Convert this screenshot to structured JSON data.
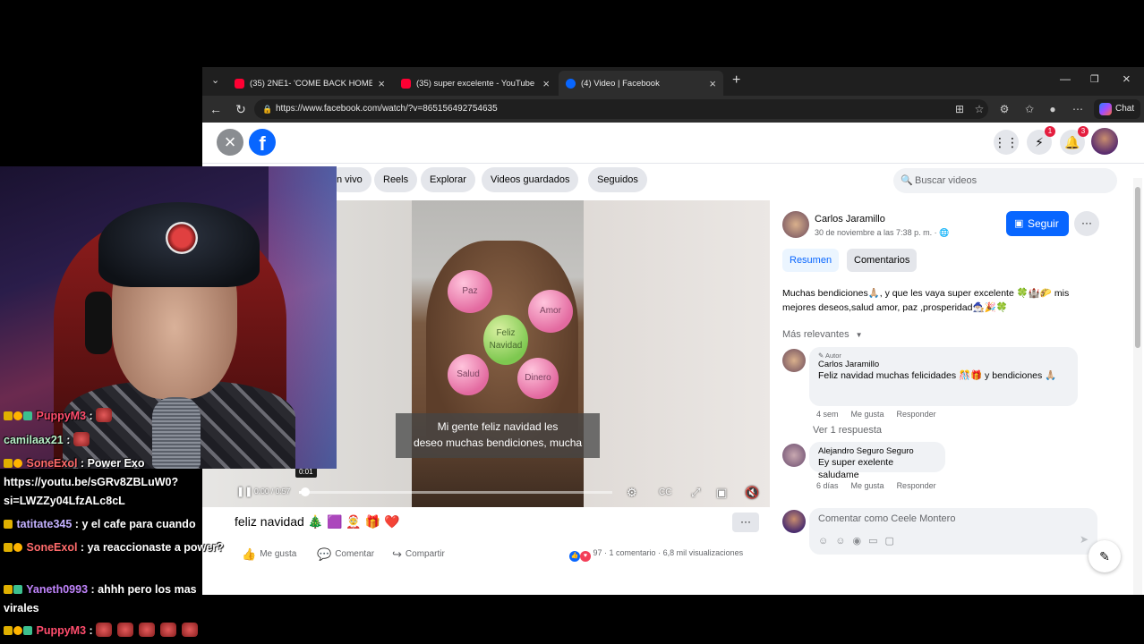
{
  "browser": {
    "tabs": [
      {
        "title": "(35) 2NE1- 'COME BACK HOME' 0:",
        "favicon": "youtube-icon",
        "color": "#ff0033"
      },
      {
        "title": "(35) super excelente - YouTube",
        "favicon": "youtube-icon",
        "color": "#ff0033"
      },
      {
        "title": "(4) Video | Facebook",
        "favicon": "facebook-icon",
        "color": "#0866ff"
      }
    ],
    "url": "https://www.facebook.com/watch/?v=865156492754635",
    "chat_label": "Chat"
  },
  "fb": {
    "messenger_badge": "1",
    "notif_badge": "3",
    "nav": [
      "n vivo",
      "Reels",
      "Explorar",
      "Videos guardados",
      "Seguidos"
    ],
    "search_placeholder": "Buscar videos",
    "video": {
      "balloons": [
        "Paz",
        "Amor",
        "Feliz Navidad",
        "Salud",
        "Dinero"
      ],
      "caption_line1": "Mi gente feliz navidad les",
      "caption_line2": "deseo muchas bendiciones, mucha",
      "time": "0:00 / 0:57",
      "hover_time": "0:01",
      "progress": 0.02,
      "title": "feliz navidad 🎄 🟪 🤶 🎁 ❤️"
    },
    "actions": {
      "like": "Me gusta",
      "comment": "Comentar",
      "share": "Compartir"
    },
    "stats": {
      "reactions": "97",
      "comments": "1 comentario",
      "views": "6,8 mil visualizaciones"
    },
    "post": {
      "author": "Carlos Jaramillo",
      "date": "30 de noviembre a las 7:38 p. m. · 🌐",
      "follow": "Seguir",
      "tab_summary": "Resumen",
      "tab_comments": "Comentarios",
      "description": "Muchas bendiciones🙏🏼, y que les vaya super excelente 🍀🏰🌮 mis mejores deseos,salud amor, paz ,prosperidad🧙🏼‍♂️🎉🍀",
      "sort": "Más relevantes"
    },
    "comments": [
      {
        "badge": "✎ Autor",
        "name": "Carlos Jaramillo",
        "text": "Feliz navidad muchas felicidades 🎊🎁 y bendiciones 🙏🏼",
        "age": "4 sem",
        "like": "Me gusta",
        "reply": "Responder"
      },
      {
        "name": "Alejandro Seguro Seguro",
        "text": "Ey super exelente saludame",
        "age": "6 días",
        "like": "Me gusta",
        "reply": "Responder"
      }
    ],
    "view_replies": "Ver 1 respuesta",
    "comment_placeholder": "Comentar como Ceele Montero"
  },
  "stream_chat": [
    {
      "user": "PuppyM3",
      "msg": "",
      "color": "#ff4d6d",
      "emotes": 1
    },
    {
      "user": "camilaax21",
      "msg": "",
      "color": "#b8f0c8",
      "emotes": 1
    },
    {
      "user": "SoneExol",
      "msg": "Power Exo https://youtu.be/sGRv8ZBLuW0?si=LWZZy04LfzALc8cL",
      "color": "#ff6b6b"
    },
    {
      "user": "tatitate345",
      "msg": "y el cafe para cuando",
      "color": "#c3b1ff"
    },
    {
      "user": "SoneExol",
      "msg": "ya reaccionaste a power?",
      "color": "#ff6b6b"
    },
    {
      "user": "Yaneth0993",
      "msg": "ahhh pero los mas virales",
      "color": "#c084fc"
    },
    {
      "user": "PuppyM3",
      "msg": "",
      "color": "#ff4d6d",
      "emotes": 5
    }
  ]
}
